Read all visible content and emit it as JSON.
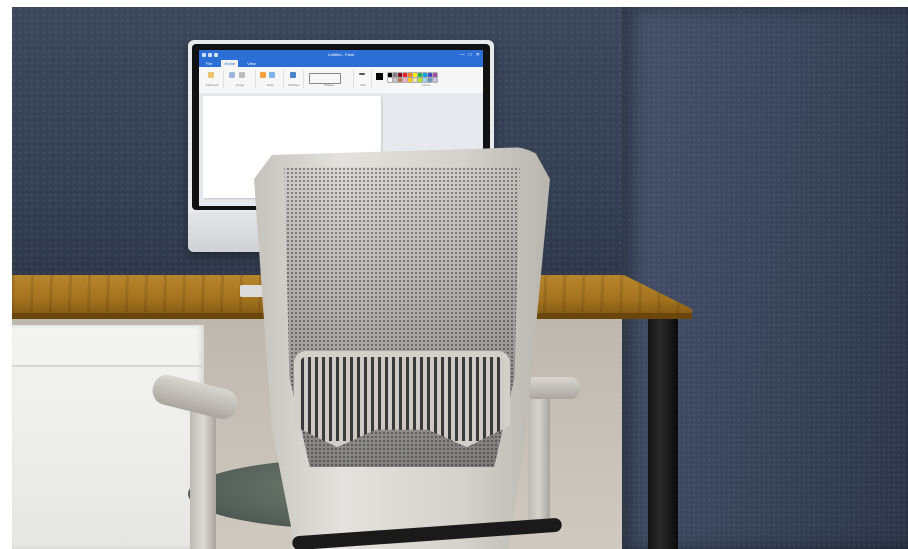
{
  "screen": {
    "window_title": "Untitled - Paint",
    "window_controls": [
      "—",
      "□",
      "✕"
    ],
    "tabs": [
      {
        "label": "File"
      },
      {
        "label": "Home"
      },
      {
        "label": "View"
      }
    ],
    "ribbon_groups": [
      {
        "label": "Clipboard"
      },
      {
        "label": "Image"
      },
      {
        "label": "Tools"
      },
      {
        "label": "Brushes"
      },
      {
        "label": "Shapes"
      },
      {
        "label": "Size"
      },
      {
        "label": "Colors"
      }
    ],
    "palette_colors": [
      "#000000",
      "#7f7f7f",
      "#880015",
      "#ed1c24",
      "#ff7f27",
      "#fff200",
      "#22b14c",
      "#00a2e8",
      "#3f48cc",
      "#a349a4",
      "#ffffff",
      "#c3c3c3",
      "#b97a57",
      "#ffaec9",
      "#ffc90e",
      "#efe4b0",
      "#b5e61d",
      "#99d9ea",
      "#7092be",
      "#c8bfe7"
    ]
  },
  "monitor": {
    "logo_icon": "apple-logo-icon",
    "logo_glyph": ""
  },
  "colors": {
    "title_bar": "#2b6fd6",
    "wall": "#3a465c",
    "desk": "#a4731e"
  }
}
